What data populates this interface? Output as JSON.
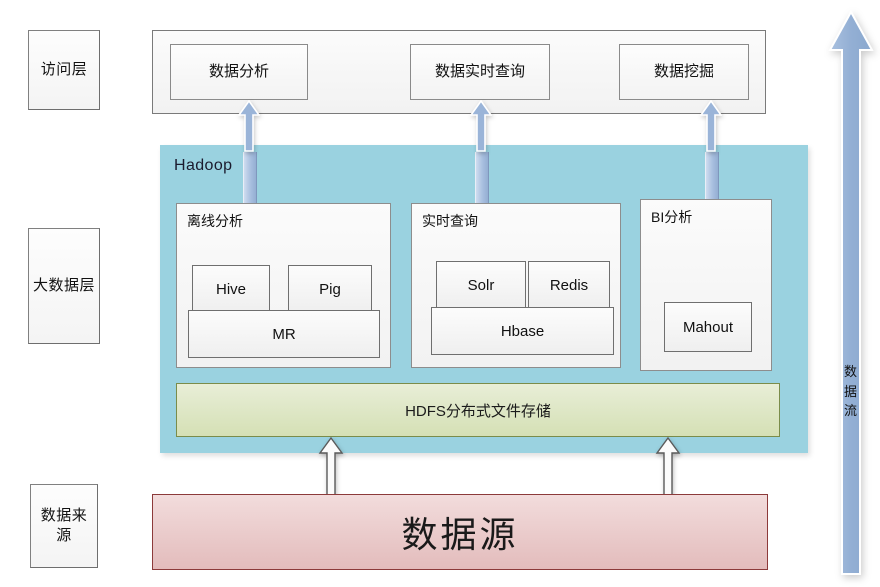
{
  "layers": {
    "access": {
      "label": "访问层"
    },
    "bigdata": {
      "label": "大数据层"
    },
    "source": {
      "label": "数据来源"
    }
  },
  "access_layer": {
    "cards": [
      {
        "label": "数据分析"
      },
      {
        "label": "数据实时查询"
      },
      {
        "label": "数据挖掘"
      }
    ]
  },
  "hadoop": {
    "title": "Hadoop",
    "modules": [
      {
        "title": "离线分析",
        "components": [
          {
            "label": "Hive"
          },
          {
            "label": "Pig"
          },
          {
            "label": "MR"
          }
        ]
      },
      {
        "title": "实时查询",
        "components": [
          {
            "label": "Solr"
          },
          {
            "label": "Redis"
          },
          {
            "label": "Hbase"
          }
        ]
      },
      {
        "title": "BI分析",
        "components": [
          {
            "label": "Mahout"
          }
        ]
      }
    ],
    "storage": {
      "label": "HDFS分布式文件存储"
    }
  },
  "data_source": {
    "label": "数据源"
  },
  "data_flow": {
    "label": "数据流",
    "direction": "up"
  },
  "colors": {
    "hadoop_background": "#9ad2e0",
    "hdfs_fill": "#d5e0b5",
    "hdfs_border": "#7a8c4a",
    "datasource_fill": "#e3bcbc",
    "datasource_border": "#8c3a3a",
    "arrow_blue": "#9ab4d8",
    "arrow_white": "#fbfbfb"
  }
}
